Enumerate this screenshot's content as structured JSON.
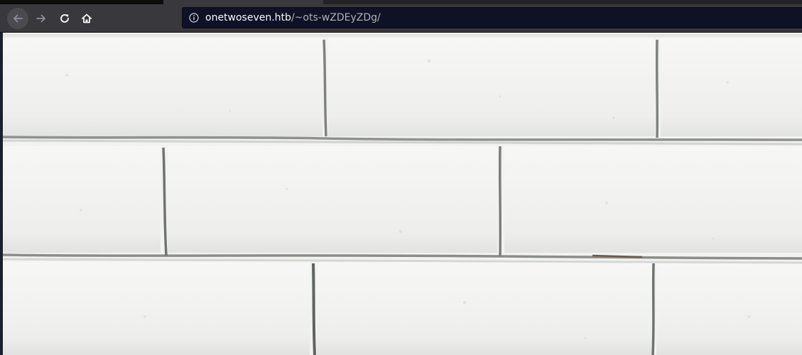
{
  "browser": {
    "nav": {
      "back_icon": "arrow-left-icon",
      "forward_icon": "arrow-right-icon",
      "reload_icon": "reload-icon",
      "home_icon": "home-icon"
    },
    "urlbar": {
      "info_icon": "info-icon",
      "host": "onetwoseven.htb",
      "path": "/~ots-wZDEyZDg/"
    }
  },
  "page": {
    "background": "white painted brick wall image"
  },
  "colors": {
    "toolbar": "#38383d",
    "urlbar_bg": "#0f1126",
    "wall": "#f3f3f3",
    "mortar": "#9a9c98"
  }
}
